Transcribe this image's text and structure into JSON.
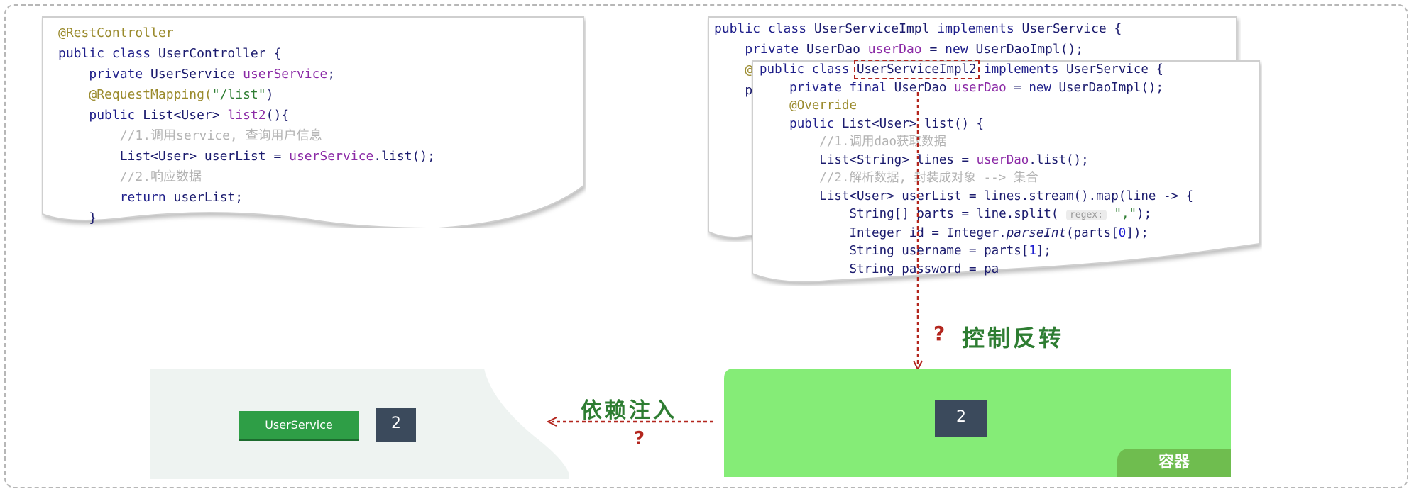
{
  "controller_code": {
    "l1": "@RestController",
    "l2_kw": "public class",
    "l2_rest": " UserController {",
    "l3_kw": "private",
    "l3_type": " UserService ",
    "l3_field": "userService",
    "l3_end": ";",
    "l4_ann": "@RequestMapping(",
    "l4_str": "\"/list\"",
    "l4_end": ")",
    "l5_kw": "public",
    "l5_type": " List<User> ",
    "l5_name": "list2",
    "l5_end": "(){",
    "l6": "//1.调用service, 查询用户信息",
    "l7_a": "List<User> userList = ",
    "l7_field": "userService",
    "l7_b": ".list();",
    "l8": "//2.响应数据",
    "l9_kw": "return",
    "l9_rest": " userList;",
    "l10": "}"
  },
  "impl1_code": {
    "l1_kw": "public class",
    "l1_name": " UserServiceImpl ",
    "l1_kw2": "implements",
    "l1_rest": " UserService {",
    "l2_kw": "private",
    "l2_type": " UserDao ",
    "l2_field": "userDao",
    "l2_mid": " = ",
    "l2_kw2": "new",
    "l2_rest": " UserDaoImpl();",
    "l3": "@",
    "l4": "p"
  },
  "impl2_code": {
    "l1_kw": "public class",
    "l1_name": "UserServiceImpl2",
    "l1_kw2": "implements",
    "l1_rest": " UserService {",
    "l2_kw": "private final",
    "l2_type": " UserDao ",
    "l2_field": "userDao",
    "l2_mid": " = ",
    "l2_kw2": "new",
    "l2_rest": " UserDaoImpl();",
    "l3": "@Override",
    "l4_kw": "public",
    "l4_rest": " List<User> list() {",
    "l5": "//1.调用dao获取数据",
    "l6_a": "List<String> lines = ",
    "l6_field": "userDao",
    "l6_b": ".list();",
    "l7": "//2.解析数据, 封装成对象 --> 集合",
    "l8": "List<User> userList = lines.stream().map(line -> {",
    "l9_a": "String[] parts = line.split( ",
    "l9_hint": "regex:",
    "l9_str": " \",\"",
    "l9_b": ");",
    "l10_a": "Integer id = Integer.",
    "l10_it": "parseInt",
    "l10_b": "(parts[",
    "l10_num": "0",
    "l10_c": "]);",
    "l11_a": "String username = parts[",
    "l11_num": "1",
    "l11_b": "];",
    "l12": "String password = pa"
  },
  "labels": {
    "ioc_q": "?",
    "ioc": "控制反转",
    "di": "依赖注入",
    "di_q": "?",
    "container": "容器",
    "userservice": "UserService",
    "bean_left": "2",
    "bean_container": "2"
  },
  "colors": {
    "container_green": "#85ec77",
    "container_tab": "#6fbd4f",
    "userservice_green": "#2e9e46",
    "arrow_red": "#b3261e",
    "label_green": "#2e7d32",
    "left_area": "#eef3f1"
  }
}
